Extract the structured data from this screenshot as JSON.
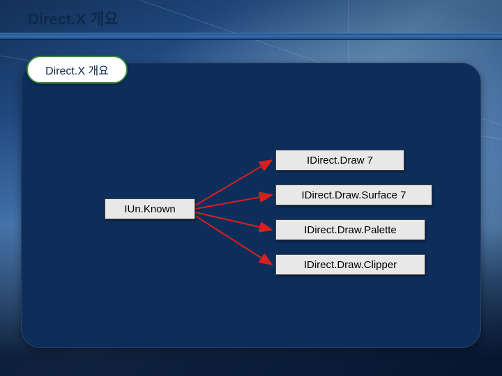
{
  "slide": {
    "title": "Direct.X 개요",
    "pill_label": "Direct.X 개요",
    "left_node": "IUn.Known",
    "right_nodes": [
      "IDirect.Draw 7",
      "IDirect.Draw.Surface 7",
      "IDirect.Draw.Palette",
      "IDirect.Draw.Clipper"
    ],
    "arrow_color": "#d82020"
  }
}
